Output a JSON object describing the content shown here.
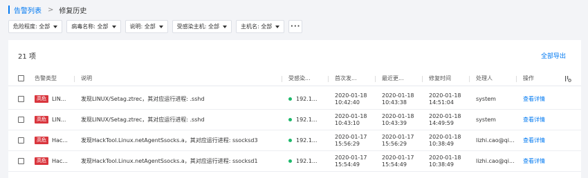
{
  "breadcrumb": {
    "parent": "告警列表",
    "separator": ">",
    "current": "修复历史"
  },
  "filters": [
    {
      "label": "危险程度: 全部"
    },
    {
      "label": "病毒名称: 全部"
    },
    {
      "label": "说明: 全部"
    },
    {
      "label": "受感染主机: 全部"
    },
    {
      "label": "主机名: 全部"
    }
  ],
  "more_label": "···",
  "table": {
    "count_label": "21 项",
    "export_label": "全部导出",
    "headers": {
      "type": "告警类型",
      "description": "说明",
      "host": "受感染...",
      "first": "首次发...",
      "last": "最近更...",
      "fixed": "修复时间",
      "handler": "处理人",
      "action": "操作"
    },
    "rows": [
      {
        "level": "高危",
        "type": "LIN...",
        "description": "发现LINUX/Setag.ztrec，其对应运行进程: .sshd",
        "host": "192.1...",
        "first_date": "2020-01-18",
        "first_time": "10:42:40",
        "last_date": "2020-01-18",
        "last_time": "10:43:38",
        "fixed_date": "2020-01-18",
        "fixed_time": "14:51:04",
        "handler": "system",
        "action": "查看详情"
      },
      {
        "level": "高危",
        "type": "LIN...",
        "description": "发现LINUX/Setag.ztrec，其对应运行进程: .sshd",
        "host": "192.1...",
        "first_date": "2020-01-18",
        "first_time": "10:43:10",
        "last_date": "2020-01-18",
        "last_time": "10:43:39",
        "fixed_date": "2020-01-18",
        "fixed_time": "14:49:59",
        "handler": "system",
        "action": "查看详情"
      },
      {
        "level": "高危",
        "type": "Hac...",
        "description": "发现HackTool.Linux.netAgentSsocks.a，其对应运行进程: ssocksd3",
        "host": "192.1...",
        "first_date": "2020-01-17",
        "first_time": "15:56:29",
        "last_date": "2020-01-17",
        "last_time": "15:56:29",
        "fixed_date": "2020-01-18",
        "fixed_time": "10:38:49",
        "handler": "lizhi.cao@qi...",
        "action": "查看详情"
      },
      {
        "level": "高危",
        "type": "Hac...",
        "description": "发现HackTool.Linux.netAgentSsocks.a，其对应运行进程: ssocksd1",
        "host": "192.1...",
        "first_date": "2020-01-17",
        "first_time": "15:54:49",
        "last_date": "2020-01-17",
        "last_time": "15:54:49",
        "fixed_date": "2020-01-18",
        "fixed_time": "10:38:49",
        "handler": "lizhi.cao@qi...",
        "action": "查看详情"
      }
    ]
  },
  "colors": {
    "accent": "#0079f2",
    "danger": "#d9363e",
    "online": "#1db86a"
  },
  "icons": {
    "column_settings": "column-settings-icon",
    "status": "status-dot-icon"
  }
}
